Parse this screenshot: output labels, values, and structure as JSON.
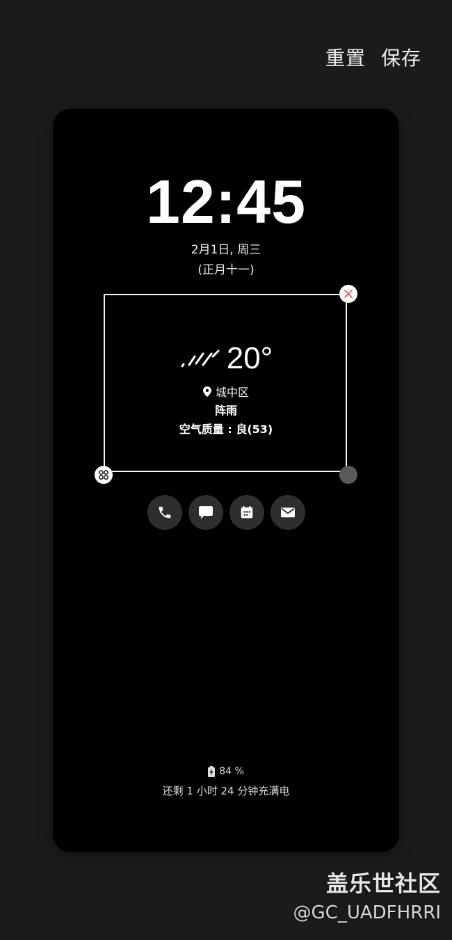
{
  "header": {
    "reset_label": "重置",
    "save_label": "保存"
  },
  "lockscreen": {
    "time": "12:45",
    "date": "2月1日, 周三",
    "lunar_date": "(正月十一)"
  },
  "weather_widget": {
    "icon": "rain-icon",
    "temperature": "20°",
    "location": "城中区",
    "condition": "阵雨",
    "air_quality": "空气质量 : 良(53)"
  },
  "shortcuts": [
    {
      "name": "phone",
      "icon": "phone-icon"
    },
    {
      "name": "messages",
      "icon": "message-icon"
    },
    {
      "name": "calendar",
      "icon": "calendar-icon"
    },
    {
      "name": "email",
      "icon": "mail-icon"
    }
  ],
  "charging": {
    "battery_percent": "84 %",
    "time_to_full": "还剩 1 小时 24 分钟充满电"
  },
  "watermark": {
    "brand": "盖乐世社区",
    "user": "@GC_UADFHRRI"
  },
  "colors": {
    "background": "#1b1b1d",
    "preview": "#000000",
    "shortcut_bg": "#2e2e2e",
    "close_x": "#e0524f"
  }
}
